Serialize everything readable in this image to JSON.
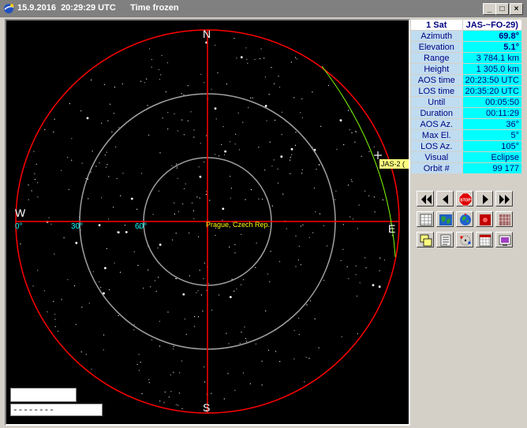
{
  "window": {
    "date": "15.9.2016",
    "time": "20:29:29 UTC",
    "status": "Time frozen",
    "controls": [
      "minimize-icon",
      "maximize-icon",
      "close-icon"
    ]
  },
  "radar": {
    "directions": {
      "north": "N",
      "south": "S",
      "east": "E",
      "west": "W"
    },
    "elevation_labels": [
      "0°",
      "30°",
      "60°"
    ],
    "location": "Prague, Czech Rep.",
    "satellite_label": "JAS-2 (",
    "colors": {
      "background": "#000000",
      "axes": "#ff0000",
      "rings": "#a0a0a0",
      "track": "#80ff00",
      "elevation_text": "#00ffff",
      "location_text": "#ffff00"
    }
  },
  "bottom_fields": {
    "field1": "",
    "field2": "--------"
  },
  "info": {
    "header": {
      "count": "1 Sat",
      "satellite": "JAS-~FO-29)"
    },
    "rows": [
      {
        "label": "Azimuth",
        "value": "69.8°",
        "bold": true
      },
      {
        "label": "Elevation",
        "value": "5.1°",
        "bold": true
      },
      {
        "label": "Range",
        "value": "3 784.1 km"
      },
      {
        "label": "Height",
        "value": "1 305.0 km"
      },
      {
        "label": "AOS time",
        "value": "20:23:50 UTC"
      },
      {
        "label": "LOS time",
        "value": "20:35:20 UTC"
      },
      {
        "label": "Until",
        "value": "00:05:50"
      },
      {
        "label": "Duration",
        "value": "00:11:29"
      },
      {
        "label": "AOS Az.",
        "value": "36°"
      },
      {
        "label": "Max El.",
        "value": "5°"
      },
      {
        "label": "LOS Az.",
        "value": "105°"
      },
      {
        "label": "Visual",
        "value": "Eclipse"
      },
      {
        "label": "Orbit #",
        "value": "99 177"
      }
    ]
  },
  "toolbar": {
    "row1": [
      "rewind-fast-icon",
      "rewind-icon",
      "stop-icon",
      "forward-icon",
      "forward-fast-icon"
    ],
    "stop_label": "STOP",
    "row2": [
      "table-icon",
      "world-map-icon",
      "globe-icon",
      "red-map-icon",
      "grid-map-icon"
    ],
    "row3": [
      "windows-icon",
      "list-icon",
      "orbit-icon",
      "calendar-icon",
      "monitor-icon"
    ]
  }
}
